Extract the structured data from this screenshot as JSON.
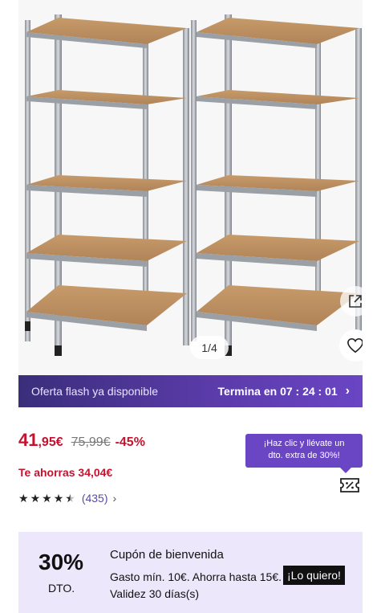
{
  "gallery": {
    "counter": "1/4",
    "share_icon": "share-external-icon",
    "favorite_icon": "heart-icon"
  },
  "flash": {
    "left_text": "Oferta flash ya disponible",
    "right_text": "Termina en 07 : 24 : 01",
    "chevron": "›"
  },
  "price": {
    "integer": "41",
    "decimal": ",95",
    "currency": "€",
    "old": "75,99€",
    "discount": "-45%",
    "savings": "Te ahorras 34,04€",
    "color": "#c4122f"
  },
  "rating": {
    "stars": 4.5,
    "count": "(435)",
    "chevron": "›"
  },
  "tooltip": {
    "line1": "¡Haz clic y llévate un",
    "line2": "dto. extra de 30%!"
  },
  "coupon": {
    "percent": "30%",
    "dto": "DTO.",
    "title": "Cupón de bienvenida",
    "description": "Gasto mín. 10€. Ahorra hasta 15€. Validez 30 días(s)",
    "cta": "¡Lo quiero!",
    "background": "#ece7fb"
  },
  "colors": {
    "accent": "#6a45c4",
    "flash_bar": "#3a2e7a"
  }
}
